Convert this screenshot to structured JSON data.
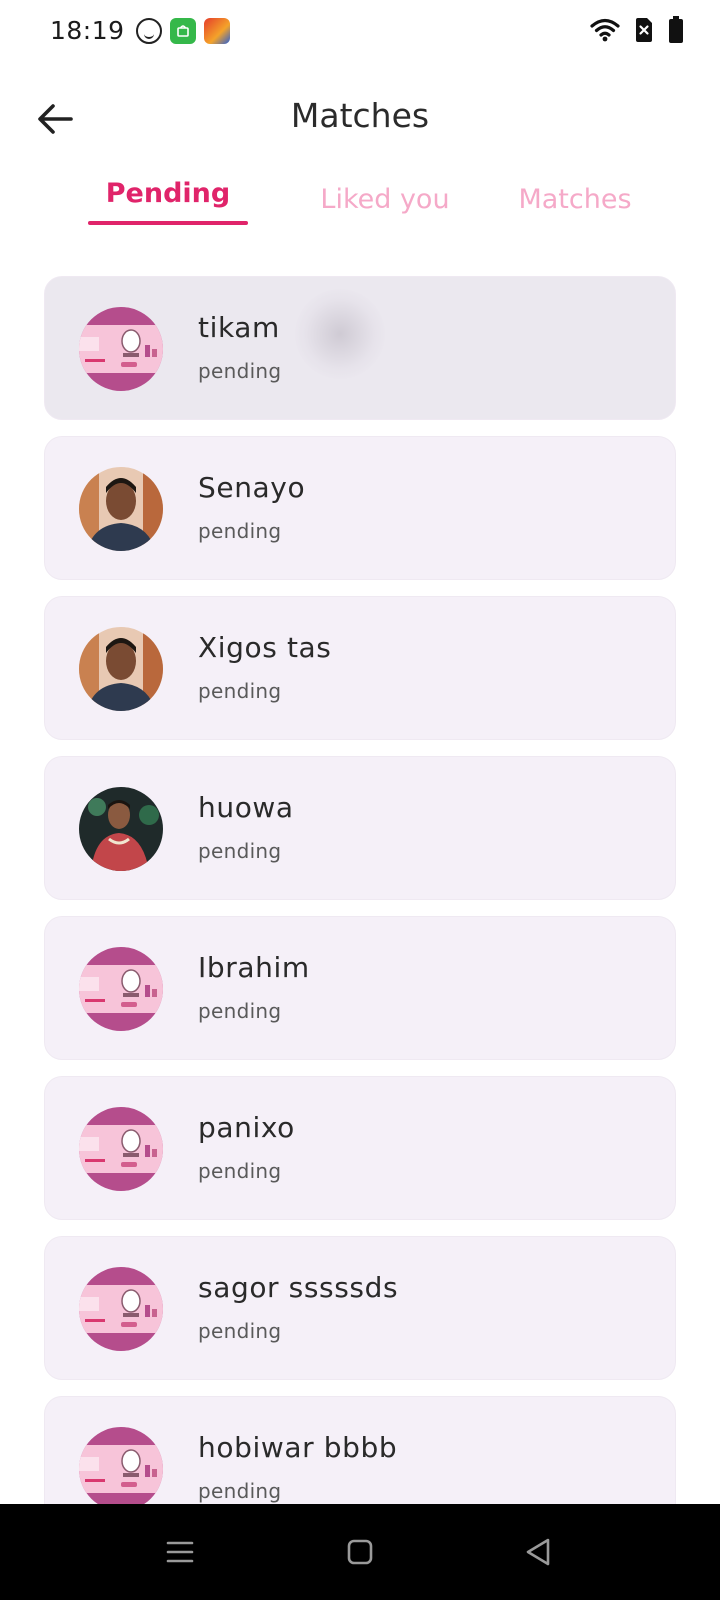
{
  "status_bar": {
    "time": "18:19",
    "notification_icons": [
      "face-app-icon",
      "shopping-app-icon",
      "game-app-icon"
    ],
    "system_icons": [
      "wifi-icon",
      "no-sim-icon",
      "battery-icon"
    ]
  },
  "header": {
    "title": "Matches",
    "back_icon": "arrow-left-icon"
  },
  "tabs": [
    {
      "label": "Pending",
      "active": true
    },
    {
      "label": "Liked you",
      "active": false
    },
    {
      "label": "Matches",
      "active": false
    }
  ],
  "matches": [
    {
      "name": "tikam",
      "status": "pending",
      "avatar": "salon-banner"
    },
    {
      "name": "Senayo",
      "status": "pending",
      "avatar": "person-photo"
    },
    {
      "name": "Xigos tas",
      "status": "pending",
      "avatar": "person-photo"
    },
    {
      "name": "huowa",
      "status": "pending",
      "avatar": "person-photo-red-shirt"
    },
    {
      "name": "Ibrahim",
      "status": "pending",
      "avatar": "salon-banner"
    },
    {
      "name": "panixo",
      "status": "pending",
      "avatar": "salon-banner"
    },
    {
      "name": "sagor sssssds",
      "status": "pending",
      "avatar": "salon-banner"
    },
    {
      "name": "hobiwar bbbb",
      "status": "pending",
      "avatar": "salon-banner"
    }
  ],
  "colors": {
    "accent": "#e0246a",
    "tab_inactive": "#f5a9c8",
    "card_background": "#f5f0f8",
    "nav_bar": "#000000"
  },
  "nav_bar": {
    "buttons": [
      "menu-icon",
      "home-icon",
      "back-triangle-icon"
    ]
  }
}
